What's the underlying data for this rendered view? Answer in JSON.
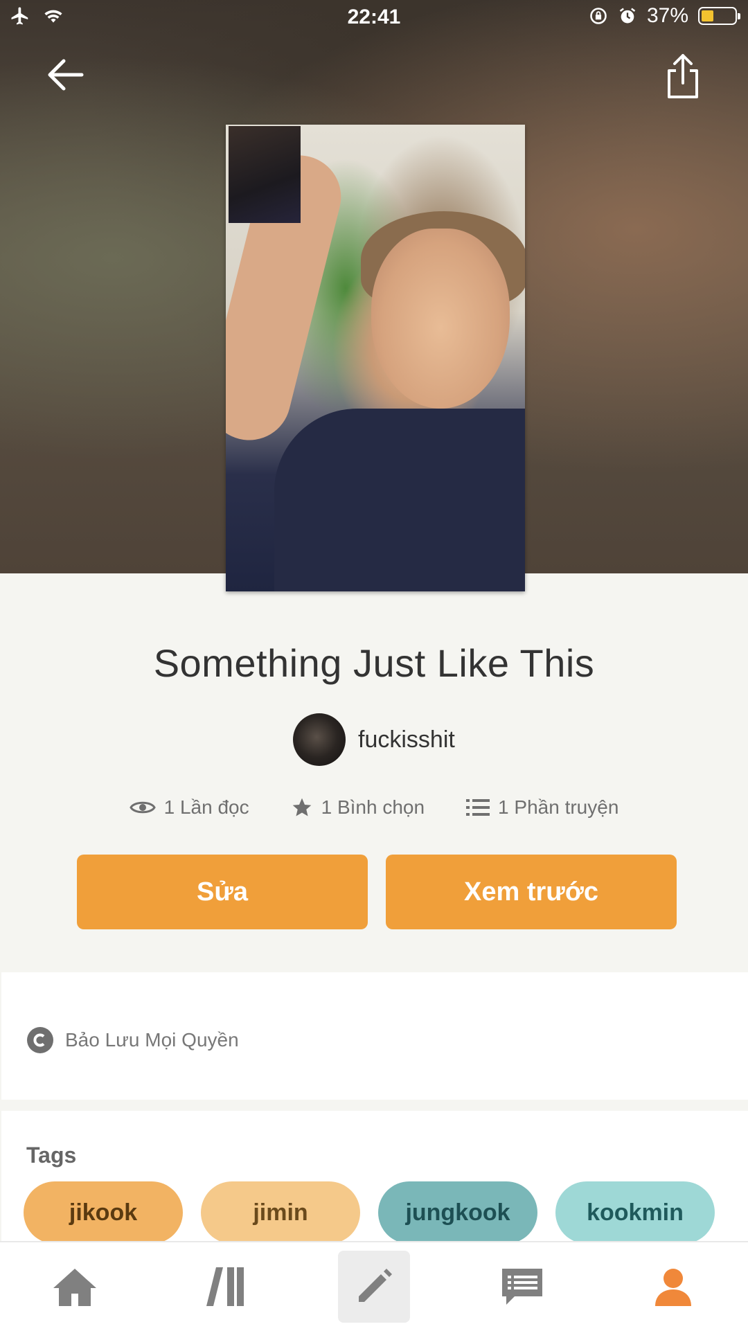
{
  "status": {
    "time": "22:41",
    "battery": "37%",
    "battery_level": 0.37
  },
  "story": {
    "title": "Something Just Like This",
    "author": "fuckisshit",
    "stats": {
      "reads": "1 Lần đọc",
      "votes": "1 Bình chọn",
      "parts": "1 Phần truyện"
    }
  },
  "actions": {
    "edit": "Sửa",
    "preview": "Xem trước"
  },
  "copyright": "Bảo Lưu Mọi Quyền",
  "tags": {
    "label": "Tags",
    "items": [
      {
        "label": "jikook",
        "bg": "#f2b363",
        "fg": "#5a3a10"
      },
      {
        "label": "jimin",
        "bg": "#f5c98a",
        "fg": "#6a4a1c"
      },
      {
        "label": "jungkook",
        "bg": "#7ab7b8",
        "fg": "#1d4f53"
      },
      {
        "label": "kookmin",
        "bg": "#9ed8d6",
        "fg": "#1f5a5c"
      }
    ]
  },
  "tabs": [
    "home",
    "library",
    "write",
    "messages",
    "profile"
  ],
  "colors": {
    "accent": "#f09f3a",
    "active_tab": "#f0883a",
    "inactive_tab": "#808080"
  }
}
